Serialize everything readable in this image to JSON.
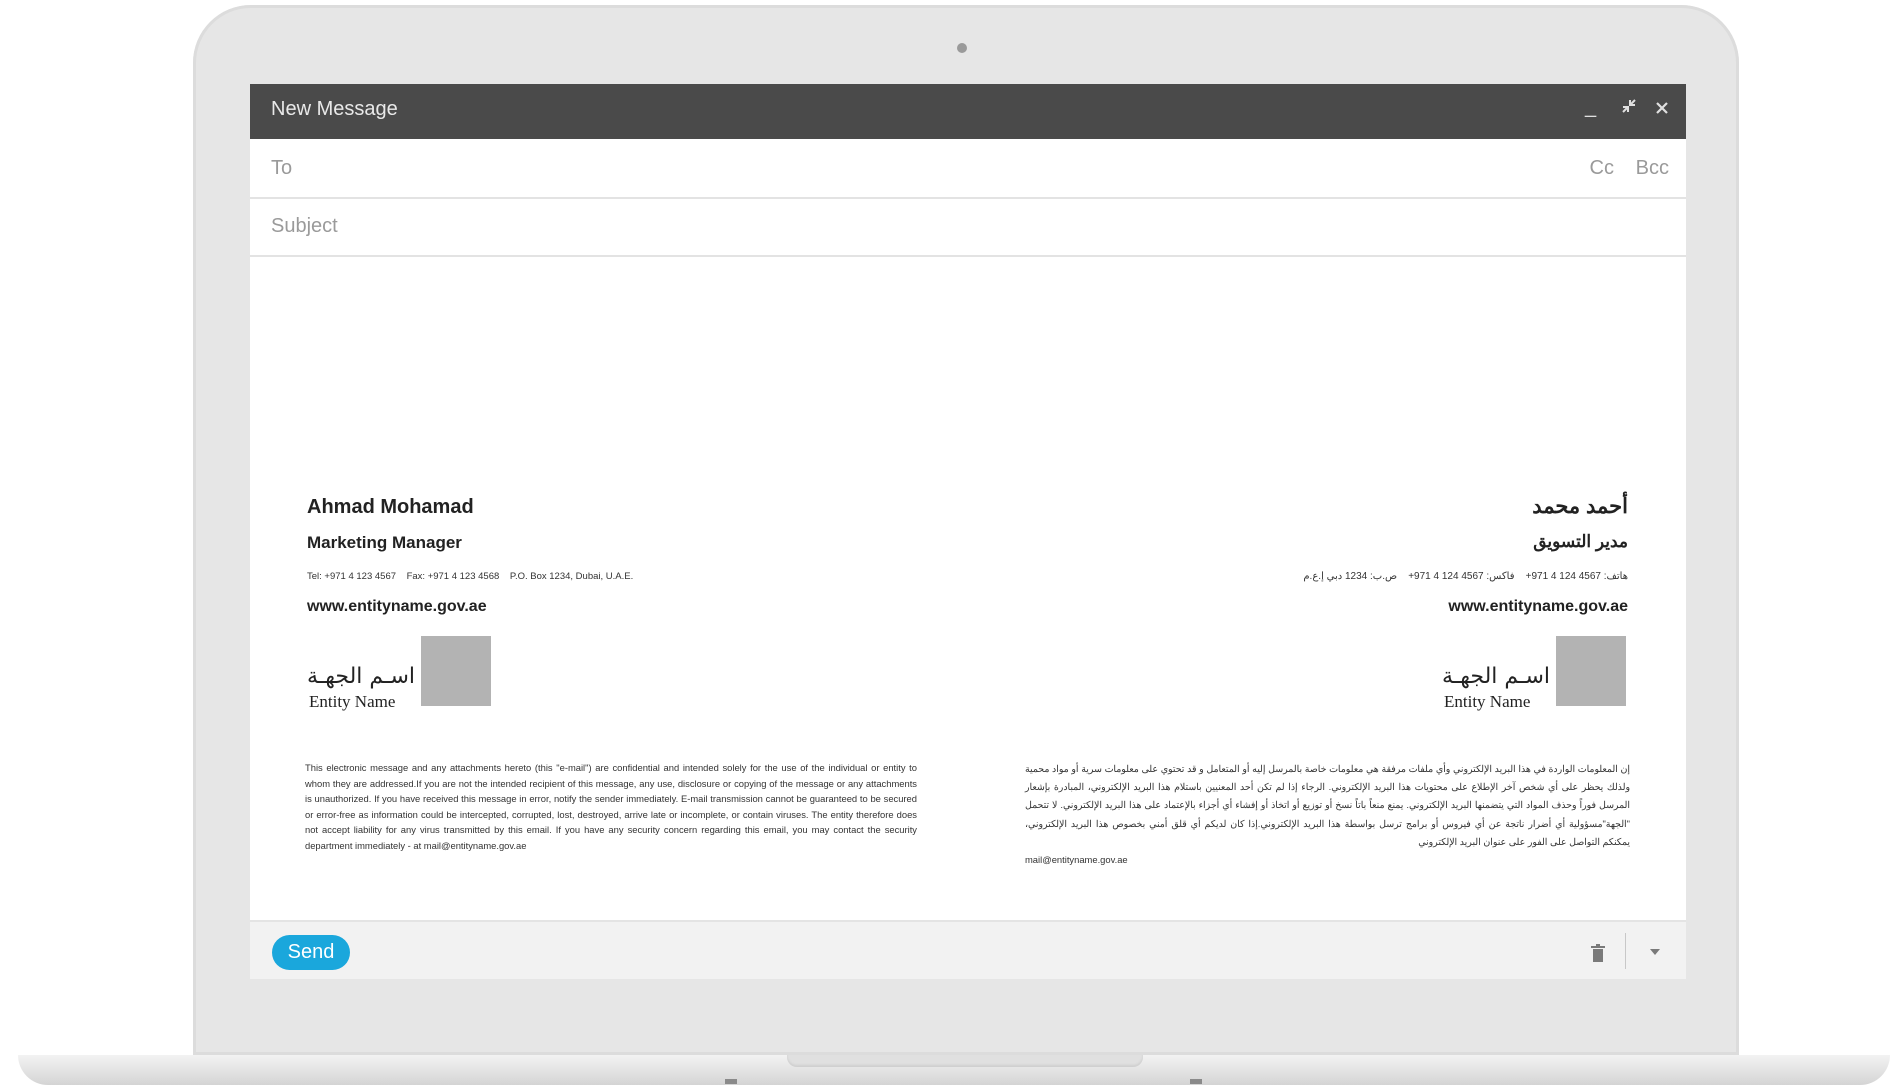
{
  "window": {
    "title": "New Message",
    "controls": {
      "minimize": "_",
      "expand": "⤡",
      "close": "✕"
    }
  },
  "fields": {
    "to_label": "To",
    "cc_label": "Cc",
    "bcc_label": "Bcc",
    "subject_label": "Subject"
  },
  "signature": {
    "en": {
      "name": "Ahmad Mohamad",
      "title": "Marketing Manager",
      "tel": "Tel: +971 4 123 4567",
      "fax": "Fax: +971 4 123 4568",
      "pobox": "P.O. Box 1234, Dubai, U.A.E.",
      "url": "www.entityname.gov.ae",
      "entity_ar": "اسـم الجهـة",
      "entity_en": "Entity Name"
    },
    "ar": {
      "name": "أحمد محمد",
      "title": "مدير التسويق",
      "tel": "هاتف: 4567 124 4 971+",
      "fax": "فاكس: 4567 124 4 971+",
      "pobox": "ص.ب: 1234 دبي إ.ع.م",
      "url": "www.entityname.gov.ae",
      "entity_ar": "اسـم الجهـة",
      "entity_en": "Entity Name"
    }
  },
  "disclaimer": {
    "en": "This electronic message and any attachments hereto (this \"e-mail\") are confidential and intended solely for the use of the individual or entity to whom they are addressed.If you are not the intended recipient of this message, any use, disclosure or copying of the message or any attachments is unauthorized. If you have received this message in error, notify the sender immediately. E-mail transmission cannot be guaranteed to be secured or error-free as information could be intercepted, corrupted, lost, destroyed, arrive late or incomplete, or contain viruses. The entity therefore does not accept liability for any virus transmitted by this email. If you have any security concern regarding this email, you may contact the security department immediately - at mail@entityname.gov.ae",
    "ar": "إن المعلومات الواردة في هذا البريد الإلكتروني وأي ملفات مرفقة هي معلومات خاصة بالمرسل إليه أو المتعامل و قد تحتوي على معلومات سرية أو مواد محمية ولذلك يحظر على أي شخص آخر الإطلاع على محتويات هذا البريد الإلكتروني. الرجاء إذا لم تكن أحد المعنيين باستلام هذا البريد الإلكتروني، المبادرة بإشعار المرسل فوراً وحذف المواد التي يتضمنها البريد الإلكتروني. يمنع منعاً باتاً نسخ أو توزيع أو اتخاذ أو إفشاء أي أجزاء بالإعتماد على هذا البريد الإلكتروني. لا تتحمل \"الجهة\"مسؤولية أي أضرار ناتجة عن أي فيروس أو برامج ترسل بواسطة هذا البريد الإلكتروني.إذا كان لديكم أي قلق أمني بخصوص هذا البريد الإلكتروني، يمكنكم التواصل على الفور على عنوان البريد الإلكتروني",
    "ar_email": "mail@entityname.gov.ae"
  },
  "footer": {
    "send_label": "Send"
  },
  "icons": {
    "trash": "trash-icon",
    "more": "chevron-down-icon"
  },
  "colors": {
    "title_bar": "#4a4a4a",
    "send_button": "#1aa7dc",
    "logo_placeholder": "#b3b3b3"
  }
}
